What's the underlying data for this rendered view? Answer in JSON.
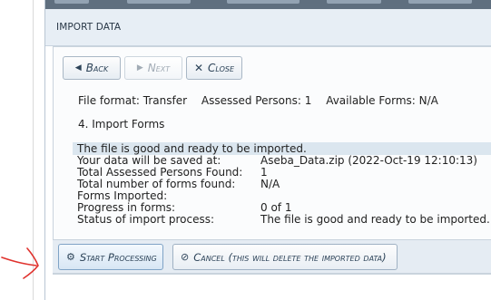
{
  "dialog": {
    "title": "IMPORT DATA"
  },
  "nav": {
    "back_label": "Back",
    "next_label": "Next",
    "close_label": "Close"
  },
  "summary": {
    "file_format": "File format: Transfer",
    "assessed_persons": "Assessed Persons: 1",
    "available_forms": "Available Forms: N/A"
  },
  "step": {
    "label": "4. Import Forms"
  },
  "status": {
    "message": "The file is good and ready to be imported."
  },
  "details": [
    {
      "key": "Your data will be saved at:",
      "value": "Aseba_Data.zip (2022-Oct-19 12:10:13)"
    },
    {
      "key": "Total Assessed Persons Found:",
      "value": "1"
    },
    {
      "key": "Total number of forms found:",
      "value": "N/A"
    },
    {
      "key": "Forms Imported:",
      "value": ""
    },
    {
      "key": "Progress in forms:",
      "value": "0 of 1"
    },
    {
      "key": "Status of import process:",
      "value": "The file is good and ready to be imported."
    }
  ],
  "actions": {
    "start_label": "Start Processing",
    "cancel_label": "Cancel (this will delete the imported data)"
  },
  "colors": {
    "titlebar_bg": "#e7eef5",
    "highlight_bg": "#dbe6ef",
    "annotation_red": "#e0322d"
  },
  "icons": {
    "back": "triangle-left-icon",
    "next": "triangle-right-icon",
    "close": "x-icon",
    "start": "process-icon",
    "cancel": "no-entry-icon"
  }
}
